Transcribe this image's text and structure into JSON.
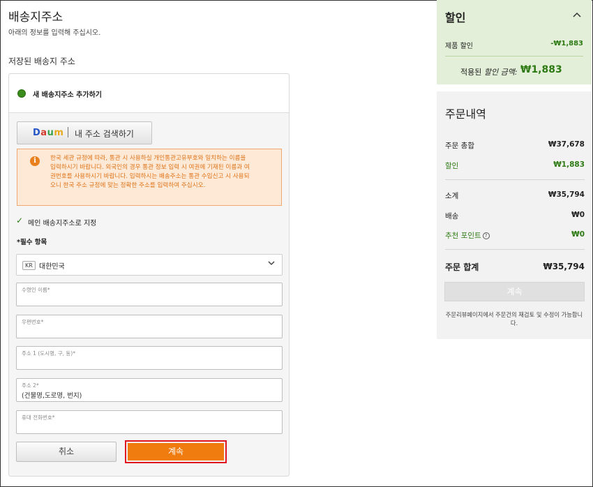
{
  "page": {
    "title": "배송지주소",
    "subtitle": "아래의 정보를 입력해 주십시오.",
    "saved_title": "저장된 배송지 주소"
  },
  "address_form": {
    "new_address_label": "새 배송지주소 추가하기",
    "daum_logo_parts": [
      "D",
      "a",
      "u",
      "m"
    ],
    "daum_search_label": "내 주소 검색하기",
    "notice_text": "한국 세관 규정에 따라, 통관 시 사용하실 개인통관고유부호와 일치하는 이름을 입력하시기 바랍니다. 외국인의 경우 통관 정보 입력 시 여권에 기재된 이름과 여권번호를 사용하시기 바랍니다. 입력하시는 배송주소는 통관 수입신고 시 사용되오니 한국 주소 규정에 맞는 정확한 주소를 입력하여 주십시오.",
    "main_address_checkbox_label": "메인 배송지주소로 지정",
    "main_address_checked": true,
    "required_label": "*필수 항목",
    "country": {
      "code": "KR",
      "name": "대한민국"
    },
    "fields": [
      {
        "placeholder": "수령인 이름*",
        "value": ""
      },
      {
        "placeholder": "우편번호*",
        "value": ""
      },
      {
        "placeholder": "주소 1 (도시명, 구, 동)*",
        "value": ""
      },
      {
        "placeholder": "주소 2*",
        "value": "(건물명,도로명, 번지)"
      },
      {
        "placeholder": "휴대 전화번호*",
        "value": ""
      }
    ],
    "cancel_label": "취소",
    "continue_label": "계속"
  },
  "discount": {
    "title": "할인",
    "product_discount_label": "제품 할인",
    "product_discount_value": "-₩1,883",
    "applied_label_prefix": "적용된 ",
    "applied_label_italic": "할인 금액:",
    "applied_value": "₩1,883"
  },
  "summary": {
    "title": "주문내역",
    "order_total_label": "주문 총합",
    "order_total_value": "₩37,678",
    "discount_label": "할인",
    "discount_value": "₩1,883",
    "subtotal_label": "소계",
    "subtotal_value": "₩35,794",
    "shipping_label": "배송",
    "shipping_value": "₩0",
    "points_label": "추천 포인트",
    "points_value": "₩0",
    "grand_total_label": "주문 합계",
    "grand_total_value": "₩35,794",
    "continue_label": "계속",
    "note": "주문리뷰페이지에서 주문건의 재검토 및 수정이 가능합니다."
  },
  "colors": {
    "accent_orange": "#f07c10",
    "highlight_red": "#e0141e",
    "green_text": "#2d7a14",
    "discount_bg": "#e3efd8"
  },
  "icons": {
    "info": "info-icon",
    "check": "check-icon",
    "chevron": "chevron-down-icon",
    "collapse": "chevron-up-icon",
    "help": "question-icon"
  }
}
